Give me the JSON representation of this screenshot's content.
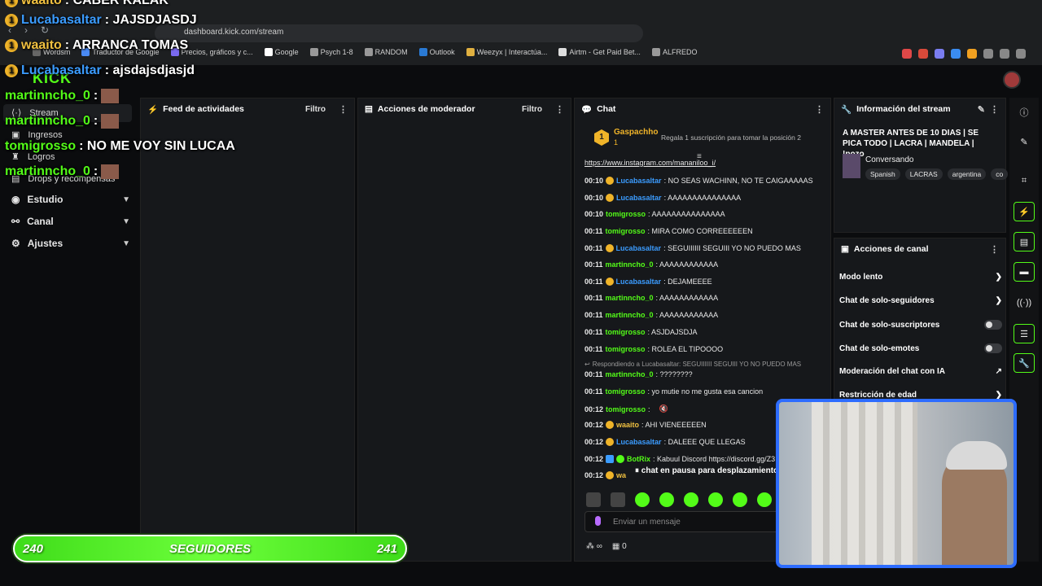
{
  "browser": {
    "url": "dashboard.kick.com/stream",
    "bookmarks": [
      "Wordsm",
      "Traductor de Google",
      "Precios, gráficos y c...",
      "Google",
      "Psych 1-8",
      "RANDOM",
      "Outlook",
      "Weezyx | Interactúa...",
      "Airtm - Get Paid Bet...",
      "ALFREDO"
    ]
  },
  "kick": {
    "logo": "KICK"
  },
  "sidebar": {
    "items": [
      {
        "label": "Stream",
        "icon": "stream-icon"
      },
      {
        "label": "Ingresos",
        "icon": "money-icon"
      },
      {
        "label": "Logros",
        "icon": "trophy-icon"
      },
      {
        "label": "Drops y recompensas",
        "icon": "gift-icon"
      },
      {
        "label": "Estudio",
        "icon": "studio-icon"
      },
      {
        "label": "Canal",
        "icon": "channel-icon"
      },
      {
        "label": "Ajustes",
        "icon": "gear-icon"
      }
    ]
  },
  "panels": {
    "activity": {
      "title": "Feed de actividades",
      "filter": "Filtro"
    },
    "mod": {
      "title": "Acciones de moderador",
      "filter": "Filtro"
    },
    "chat": {
      "title": "Chat"
    },
    "info": {
      "title": "Información del stream"
    },
    "channel": {
      "title": "Acciones de canal"
    }
  },
  "chat": {
    "pinned_user": "Gaspachho",
    "pinned_count": "1",
    "pinned_note": "Regala 1 suscripción para tomar la posición 2",
    "link_line": "https://www.instagram.com/mananiloo_i/",
    "messages": [
      {
        "t": "00:10",
        "u": "Lucabasaltar",
        "c": "blue",
        "sub": true,
        "m": ": NO SEAS WACHINN, NO TE CAIGAAAAAS"
      },
      {
        "t": "00:10",
        "u": "Lucabasaltar",
        "c": "blue",
        "sub": true,
        "m": ": AAAAAAAAAAAAAAA"
      },
      {
        "t": "00:10",
        "u": "tomigrosso",
        "c": "green",
        "sub": false,
        "m": ": AAAAAAAAAAAAAAA"
      },
      {
        "t": "00:11",
        "u": "tomigrosso",
        "c": "green",
        "sub": false,
        "m": ": MIRA COMO CORREEEEEEN"
      },
      {
        "t": "00:11",
        "u": "Lucabasaltar",
        "c": "blue",
        "sub": true,
        "m": ": SEGUIIIIII SEGUIII YO NO PUEDO MAS"
      },
      {
        "t": "00:11",
        "u": "martinncho_0",
        "c": "green",
        "sub": false,
        "m": ": AAAAAAAAAAAA"
      },
      {
        "t": "00:11",
        "u": "Lucabasaltar",
        "c": "blue",
        "sub": true,
        "m": ": DEJAMEEEE"
      },
      {
        "t": "00:11",
        "u": "martinncho_0",
        "c": "green",
        "sub": false,
        "m": ": AAAAAAAAAAAA"
      },
      {
        "t": "00:11",
        "u": "martinncho_0",
        "c": "green",
        "sub": false,
        "m": ": AAAAAAAAAAAA"
      },
      {
        "t": "00:11",
        "u": "tomigrosso",
        "c": "green",
        "sub": false,
        "m": ": ASJDAJSDJA"
      },
      {
        "t": "00:11",
        "u": "tomigrosso",
        "c": "green",
        "sub": false,
        "m": ": ROLEA EL TIPOOOO"
      }
    ],
    "reply_note": "Respondiendo a Lucabasaltar: SEGUIIIIII SEGUIII YO NO PUEDO MAS",
    "messages2": [
      {
        "t": "00:11",
        "u": "martinncho_0",
        "c": "green",
        "sub": false,
        "m": ": ????????"
      },
      {
        "t": "00:11",
        "u": "tomigrosso",
        "c": "green",
        "sub": false,
        "m": ": yo mutie no me gusta esa cancion"
      },
      {
        "t": "00:12",
        "u": "tomigrosso",
        "c": "green",
        "sub": false,
        "m": ":"
      },
      {
        "t": "00:12",
        "u": "waaito",
        "c": "yellow",
        "sub": true,
        "m": ": AHI VIENEEEEEN"
      },
      {
        "t": "00:12",
        "u": "Lucabasaltar",
        "c": "blue",
        "sub": true,
        "m": ": DALEEE QUE LLEGAS"
      },
      {
        "t": "00:12",
        "u": "BotRix",
        "c": "green",
        "sub": false,
        "m": ": Kabuul Discord https://discord.gg/Z3"
      },
      {
        "t": "00:12",
        "u": "wa",
        "c": "yellow",
        "sub": true,
        "m": ""
      }
    ],
    "paused": "chat en pausa para desplazamiento",
    "input_placeholder": "Enviar un mensaje",
    "footer_count": "0",
    "infinity": "∞"
  },
  "info": {
    "title": "A MASTER ANTES DE 10 DIAS | SE PICA TODO | LACRA | MANDELA | !pozo",
    "category": "Conversando",
    "tags": [
      "Spanish",
      "LACRAS",
      "argentina",
      "co"
    ]
  },
  "channel_actions": [
    {
      "label": "Modo lento",
      "kind": "chevron"
    },
    {
      "label": "Chat de solo-seguidores",
      "kind": "chevron"
    },
    {
      "label": "Chat de solo-suscriptores",
      "kind": "toggle"
    },
    {
      "label": "Chat de solo-emotes",
      "kind": "toggle"
    },
    {
      "label": "Moderación del chat con IA",
      "kind": "external"
    },
    {
      "label": "Restricción de edad",
      "kind": "chevron"
    }
  ],
  "overlay": {
    "lines": [
      {
        "user": "waaito",
        "msg": ": CABER KALAK",
        "color": "yellow",
        "badge": true
      },
      {
        "user": "Lucabasaltar",
        "msg": ": JAJSDJASDJ",
        "color": "blue",
        "badge": true
      },
      {
        "user": "waaito",
        "msg": ": ARRANCA TOMAS",
        "color": "yellow",
        "badge": true
      },
      {
        "user": "Lucabasaltar",
        "msg": ": ajsdajsdjasjd",
        "color": "blue",
        "badge": true
      },
      {
        "user": "martinncho_0",
        "msg": " :",
        "color": "green",
        "face": true
      },
      {
        "user": "martinncho_0",
        "msg": " :",
        "color": "green",
        "face": true
      },
      {
        "user": "tomigrosso",
        "msg": " : NO ME VOY SIN LUCAA",
        "color": "green"
      },
      {
        "user": "martinncho_0",
        "msg": " :",
        "color": "green",
        "face": true
      }
    ]
  },
  "followers": {
    "current": "240",
    "label": "SEGUIDORES",
    "goal": "241",
    "progress_fraction": 0.99
  },
  "colors": {
    "kick_green": "#53fc18",
    "accent_blue": "#3b9cff",
    "sub_gold": "#f0b429"
  }
}
